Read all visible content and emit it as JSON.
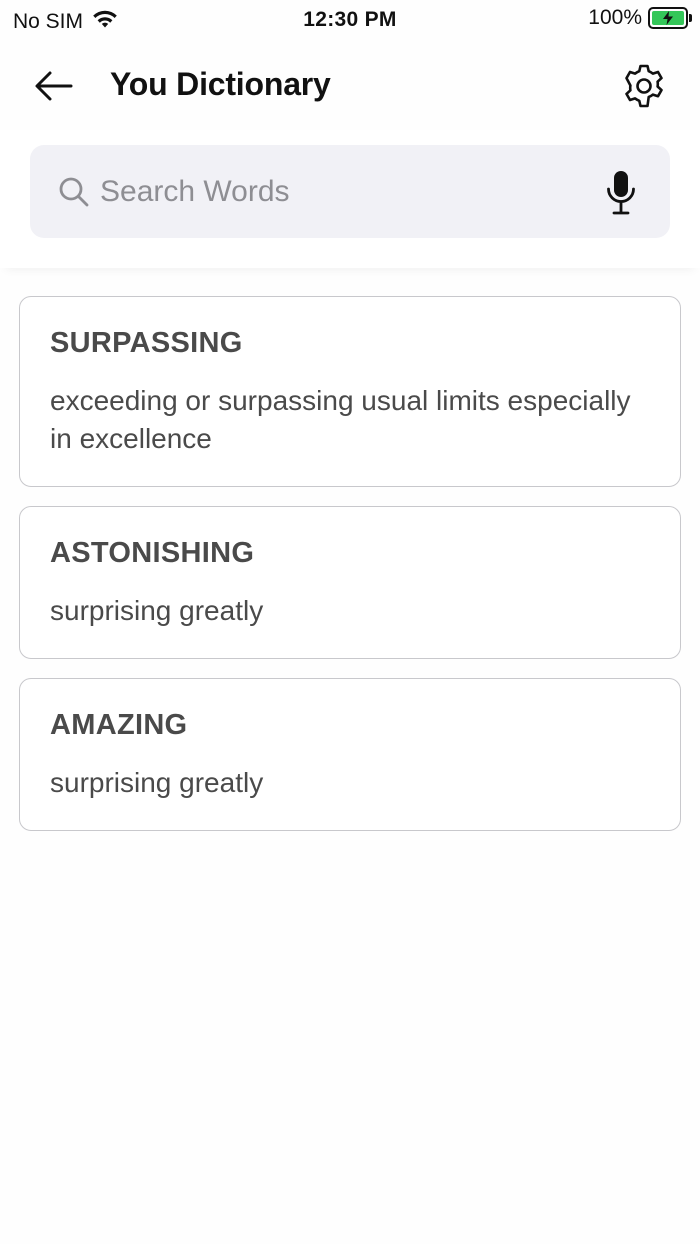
{
  "status_bar": {
    "carrier": "No SIM",
    "time": "12:30 PM",
    "battery_percent": "100%",
    "battery_color": "#34c759"
  },
  "header": {
    "title": "You Dictionary",
    "back_icon": "arrow-left-icon",
    "settings_icon": "gear-icon"
  },
  "search": {
    "placeholder": "Search Words",
    "value": "",
    "search_icon": "search-icon",
    "mic_icon": "microphone-icon"
  },
  "words": [
    {
      "term": "SURPASSING",
      "definition": "exceeding or surpassing usual limits especially in excellence"
    },
    {
      "term": "ASTONISHING",
      "definition": "surprising greatly"
    },
    {
      "term": "AMAZING",
      "definition": "surprising greatly"
    }
  ]
}
